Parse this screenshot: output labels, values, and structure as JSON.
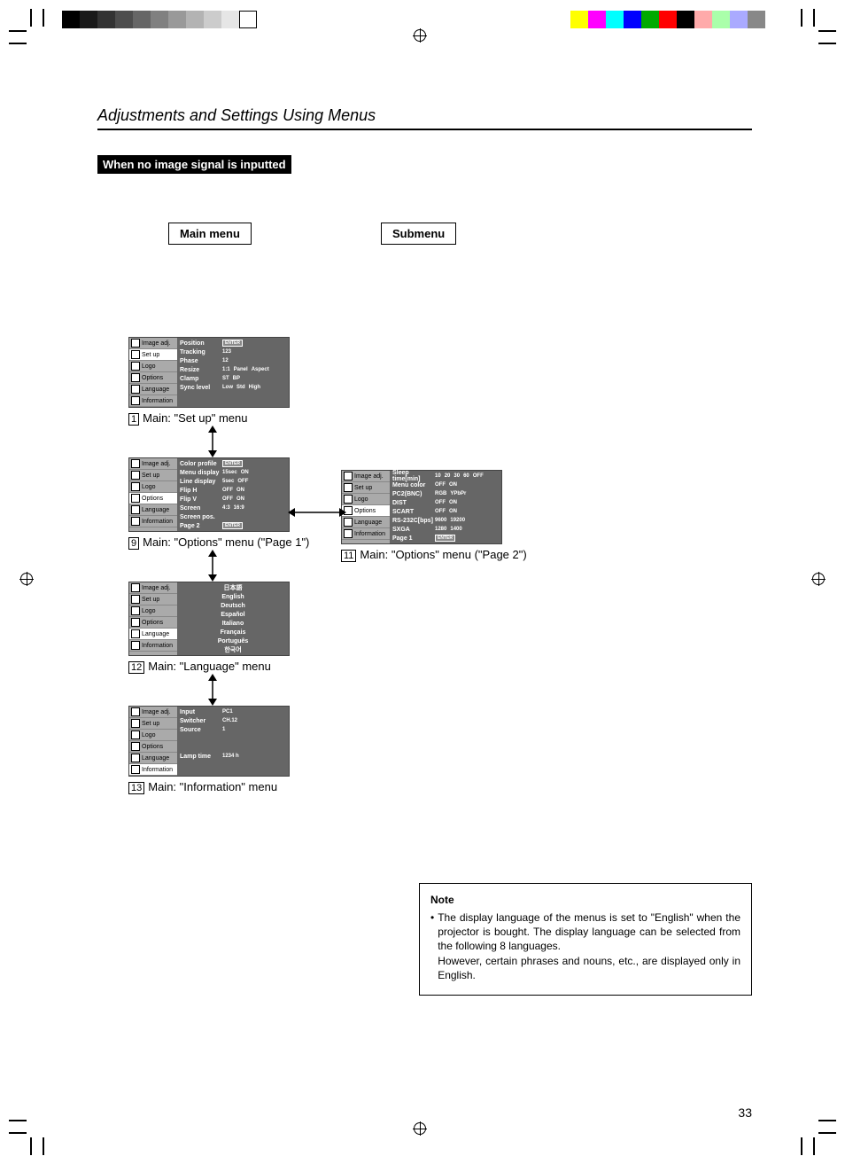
{
  "page": {
    "title": "Adjustments and Settings Using Menus",
    "bannerText": "When no image signal is inputted",
    "mainMenuLabel": "Main menu",
    "subMenuLabel": "Submenu",
    "pageNumber": "33"
  },
  "sidebarItems": [
    "Image adj.",
    "Set up",
    "Logo",
    "Options",
    "Language",
    "Information"
  ],
  "panel1": {
    "selected": 1,
    "rows": [
      {
        "label": "Position",
        "vals": [
          "ENTER"
        ]
      },
      {
        "label": "Tracking",
        "vals": [
          "123"
        ]
      },
      {
        "label": "Phase",
        "vals": [
          "12"
        ]
      },
      {
        "label": "Resize",
        "vals": [
          "1:1",
          "Panel",
          "Aspect"
        ]
      },
      {
        "label": "Clamp",
        "vals": [
          "ST",
          "BP"
        ]
      },
      {
        "label": "Sync level",
        "vals": [
          "Low",
          "Std",
          "High"
        ]
      }
    ],
    "captionNum": "1",
    "caption": "Main: \"Set up\" menu"
  },
  "panel2": {
    "selected": 3,
    "rows": [
      {
        "label": "Color profile",
        "vals": [
          "ENTER"
        ]
      },
      {
        "label": "Menu display",
        "vals": [
          "15sec",
          "ON"
        ]
      },
      {
        "label": "Line display",
        "vals": [
          "5sec",
          "OFF"
        ]
      },
      {
        "label": "Flip H",
        "vals": [
          "OFF",
          "ON"
        ]
      },
      {
        "label": "Flip V",
        "vals": [
          "OFF",
          "ON"
        ]
      },
      {
        "label": "Screen",
        "vals": [
          "4:3",
          "16:9"
        ]
      },
      {
        "label": "Screen pos.",
        "vals": [
          ""
        ]
      },
      {
        "label": "Page 2",
        "vals": [
          "ENTER"
        ]
      }
    ],
    "captionNum": "9",
    "caption": "Main: \"Options\" menu (\"Page 1\")"
  },
  "panel3": {
    "selected": 3,
    "rows": [
      {
        "label": "Sleep time[min]",
        "vals": [
          "10",
          "20",
          "30",
          "60",
          "OFF"
        ]
      },
      {
        "label": "Menu color",
        "vals": [
          "OFF",
          "ON"
        ]
      },
      {
        "label": "PC2(BNC)",
        "vals": [
          "RGB",
          "YPbPr"
        ]
      },
      {
        "label": "DIST",
        "vals": [
          "OFF",
          "ON"
        ]
      },
      {
        "label": "SCART",
        "vals": [
          "OFF",
          "ON"
        ]
      },
      {
        "label": "RS-232C[bps]",
        "vals": [
          "9600",
          "19200"
        ]
      },
      {
        "label": "SXGA",
        "vals": [
          "1280",
          "1400"
        ]
      },
      {
        "label": "Page 1",
        "vals": [
          "ENTER"
        ]
      }
    ],
    "captionNum": "11",
    "caption": "Main: \"Options\" menu (\"Page 2\")"
  },
  "panel4": {
    "selected": 4,
    "langs": [
      "日本語",
      "English",
      "Deutsch",
      "Español",
      "Italiano",
      "Français",
      "Português",
      "한국어"
    ],
    "captionNum": "12",
    "caption": "Main: \"Language\" menu"
  },
  "panel5": {
    "selected": 5,
    "rows": [
      {
        "label": "Input",
        "vals": [
          "PC1"
        ]
      },
      {
        "label": "Switcher",
        "vals": [
          "CH.12"
        ]
      },
      {
        "label": "Source",
        "vals": [
          "1"
        ]
      },
      {
        "label": "",
        "vals": [
          ""
        ]
      },
      {
        "label": "",
        "vals": [
          ""
        ]
      },
      {
        "label": "Lamp time",
        "vals": [
          "1234 h"
        ]
      }
    ],
    "captionNum": "13",
    "caption": "Main: \"Information\" menu"
  },
  "note": {
    "title": "Note",
    "bullet": "•",
    "text": "The display language of the menus is set to \"English\" when the projector is bought. The display language can be selected from the following 8 languages.\nHowever, certain phrases and nouns, etc., are displayed only in English."
  }
}
